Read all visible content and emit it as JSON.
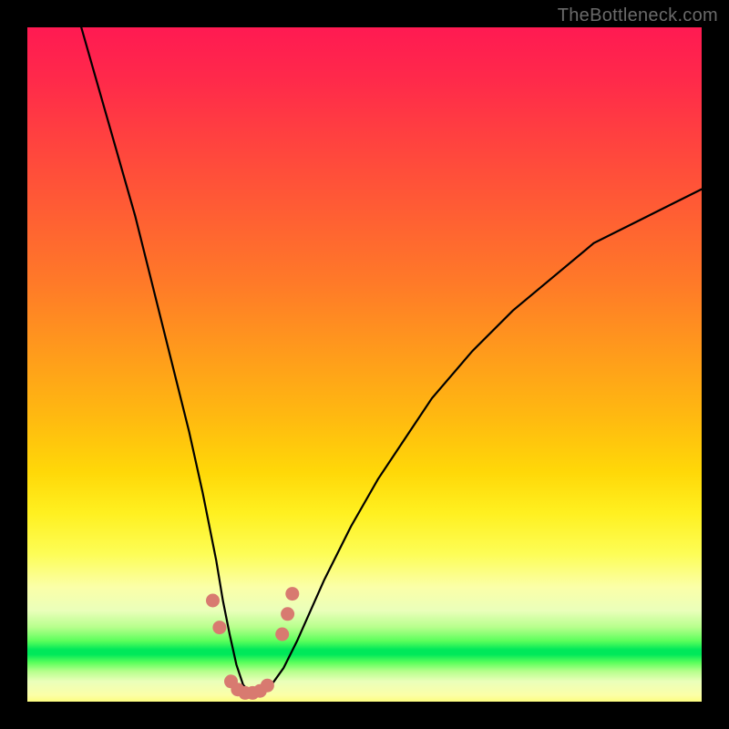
{
  "watermark": "TheBottleneck.com",
  "colors": {
    "frame": "#000000",
    "curve": "#000000",
    "marker": "#d87a70",
    "gradient_stops": [
      "#ff1a52",
      "#ff2a4a",
      "#ff4040",
      "#ff5a35",
      "#ff7a28",
      "#ff9a1c",
      "#ffba10",
      "#ffd808",
      "#fff020",
      "#fdfd55",
      "#fbffa8",
      "#eaffba",
      "#b6ff8c",
      "#5bff5b",
      "#00e85a"
    ]
  },
  "chart_data": {
    "type": "line",
    "title": "",
    "xlabel": "",
    "ylabel": "",
    "xlim": [
      0,
      100
    ],
    "ylim": [
      0,
      100
    ],
    "grid": false,
    "legend": false,
    "series": [
      {
        "name": "bottleneck-curve",
        "x": [
          8,
          10,
          12,
          14,
          16,
          18,
          20,
          22,
          24,
          26,
          28,
          29,
          30,
          31,
          32,
          33,
          34,
          35,
          36,
          38,
          40,
          44,
          48,
          52,
          56,
          60,
          66,
          72,
          78,
          84,
          90,
          96,
          100
        ],
        "y": [
          100,
          93,
          86,
          79,
          72,
          64,
          56,
          48,
          40,
          31,
          21,
          15,
          10,
          5.5,
          2.5,
          1.4,
          1.2,
          1.4,
          2.2,
          5,
          9,
          18,
          26,
          33,
          39,
          45,
          52,
          58,
          63,
          68,
          71,
          74,
          76
        ]
      }
    ],
    "markers": {
      "name": "highlight-dots",
      "color": "#d87a70",
      "points": [
        {
          "x": 27.5,
          "y": 15
        },
        {
          "x": 28.5,
          "y": 11
        },
        {
          "x": 30.2,
          "y": 3.0
        },
        {
          "x": 31.2,
          "y": 1.8
        },
        {
          "x": 32.3,
          "y": 1.3
        },
        {
          "x": 33.4,
          "y": 1.3
        },
        {
          "x": 34.5,
          "y": 1.6
        },
        {
          "x": 35.6,
          "y": 2.4
        },
        {
          "x": 37.8,
          "y": 10
        },
        {
          "x": 38.6,
          "y": 13
        },
        {
          "x": 39.3,
          "y": 16
        }
      ]
    },
    "note": "x and y are in percent of plot area (0–100). y=0 is bottom (green band), y=100 is top (red)."
  }
}
